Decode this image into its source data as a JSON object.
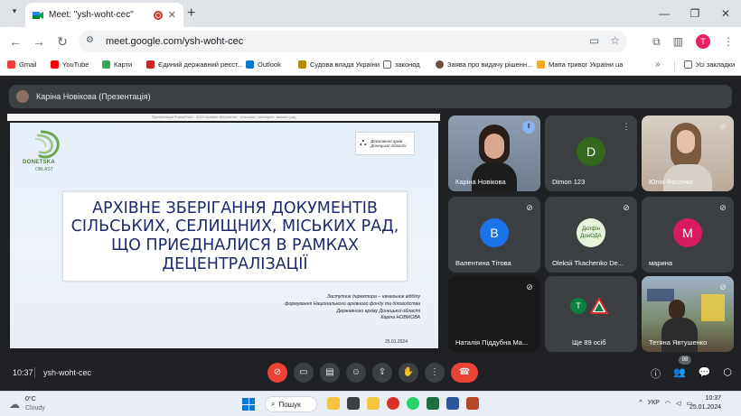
{
  "browser": {
    "tab_title": "Meet: \"ysh-woht-cec\"",
    "url": "meet.google.com/ysh-woht-cec",
    "profile_initial": "T"
  },
  "bookmarks": [
    {
      "label": "Gmail",
      "color": "#ea4335"
    },
    {
      "label": "YouTube",
      "color": "#ff0000"
    },
    {
      "label": "Карти",
      "color": "#34a853"
    },
    {
      "label": "Єдиний державний реєст...",
      "color": "#c62828"
    },
    {
      "label": "Outlook",
      "color": "#0078d4"
    },
    {
      "label": "Судова влада України",
      "color": "#b58900"
    },
    {
      "label": "законод",
      "color": "#5f6368"
    },
    {
      "label": "Заява про видачу рішенн...",
      "color": "#6d4c41"
    },
    {
      "label": "Мапа тривог України ua",
      "color": "#f9a825"
    },
    {
      "label": "Усі закладки",
      "color": "#5f6368"
    }
  ],
  "meet": {
    "presenter_label": "Каріна Новікова (Презентація)",
    "slide": {
      "top_strip": "Презентация PowerPoint - 2024 Архівне зберігання - сільських, селищних, міських рад",
      "logo_left_line1": "DONETSKA",
      "logo_left_line2": "OBLAST",
      "logo_right_text": "Державний архів Донецької області",
      "title": "АРХІВНЕ ЗБЕРІГАННЯ ДОКУМЕНТІВ\nСІЛЬСЬКИХ, СЕЛИЩНИХ, МІСЬКИХ РАД,\nЩО ПРИЄДНАЛИСЯ В РАМКАХ\nДЕЦЕНТРАЛІЗАЦІЇ",
      "footer": "Заступник директора – начальник відділу\nформування Національного архівного фонду та діловодства\nДержавного архіву Донецької області\nКаріна НОВІКОВА",
      "date": "25.01.2024"
    },
    "participants": [
      {
        "name": "Каріна Новікова",
        "type": "photo"
      },
      {
        "name": "Dimon 123",
        "type": "avatar",
        "initial": "D",
        "color": "#33691e"
      },
      {
        "name": "Юлія Фесенко",
        "type": "photo"
      },
      {
        "name": "Валентина Тітова",
        "type": "avatar",
        "initial": "В",
        "color": "#1a73e8"
      },
      {
        "name": "Oleksii Tkachenko De...",
        "type": "logo",
        "initial": "Дєпфін ДонОДА",
        "color": "#e6f2d9"
      },
      {
        "name": "марина",
        "type": "avatar",
        "initial": "М",
        "color": "#d81b60"
      },
      {
        "name": "Наталія Піддубна Ма...",
        "type": "dark"
      },
      {
        "name": "Ще 89 осіб",
        "type": "more",
        "initial": "Т",
        "color": "#0b8043"
      },
      {
        "name": "Тетяна Явтушенко",
        "type": "photo"
      }
    ],
    "clock": "10:37",
    "meeting_code": "ysh-woht-cec",
    "participant_count": "98"
  },
  "taskbar": {
    "temperature": "0°C",
    "condition": "Cloudy",
    "search_label": "Пошук",
    "language": "УКР",
    "time": "10:37",
    "date": "25.01.2024"
  }
}
